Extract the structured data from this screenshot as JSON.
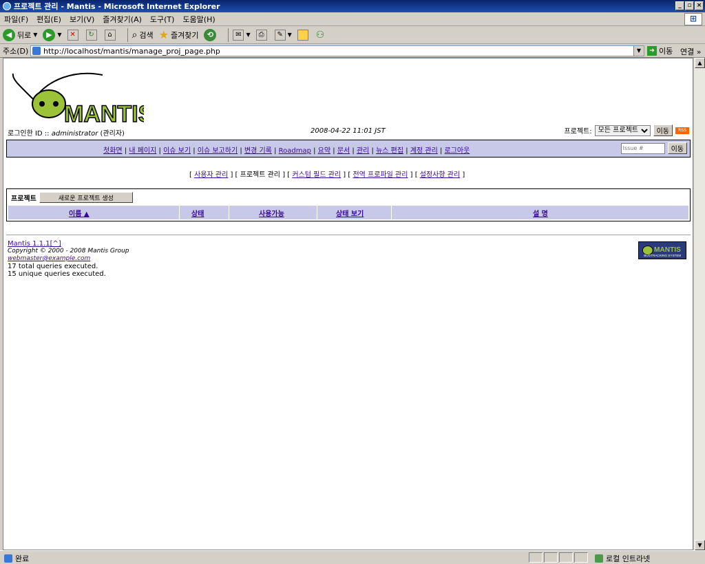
{
  "window": {
    "title": "프로젝트 관리 - Mantis - Microsoft Internet Explorer"
  },
  "menu": [
    "파일(F)",
    "편집(E)",
    "보기(V)",
    "즐겨찾기(A)",
    "도구(T)",
    "도움말(H)"
  ],
  "toolbar": {
    "back": "뒤로",
    "search": "검색",
    "favorites": "즐겨찾기"
  },
  "address": {
    "label": "주소(D)",
    "url": "http://localhost/mantis/manage_proj_page.php",
    "go": "이동",
    "links": "연결 »"
  },
  "header": {
    "login_label": "로그인한 ID :: ",
    "username": "administrator",
    "role": " (관리자)",
    "datetime": "2008-04-22 11:01 JST",
    "project_label": "프로젝트:",
    "project_selected": "모든 프로젝트",
    "go_button": "이동",
    "rss": "RSS"
  },
  "nav": {
    "items": [
      "첫화면",
      "내 페이지",
      "이슈 보기",
      "이슈 보고하기",
      "변경 기록",
      "Roadmap",
      "요약",
      "문서",
      "관리",
      "뉴스 편집",
      "계정 관리",
      "로그아웃"
    ],
    "issue_placeholder": "Issue #",
    "go_button": "이동"
  },
  "submenu": {
    "items": [
      "사용자 관리",
      "프로젝트 관리",
      "커스텀 필드 관리",
      "전역 프로파일 관리",
      "설정사항 관리"
    ],
    "active": "프로젝트 관리"
  },
  "projects": {
    "title": "프로젝트",
    "create_button": "새로운 프로젝트 생성",
    "columns": [
      "이름 ▲",
      "상태",
      "사용가능",
      "상태 보기",
      "설 명"
    ]
  },
  "footer": {
    "version_link": "Mantis 1.1.1",
    "top_link": "[^]",
    "copyright": "Copyright © 2000 - 2008 Mantis Group",
    "email": "webmaster@example.com",
    "queries_total": "17 total queries executed.",
    "queries_unique": "15 unique queries executed."
  },
  "status": {
    "text": "완료",
    "zone": "로컬 인트라넷"
  }
}
